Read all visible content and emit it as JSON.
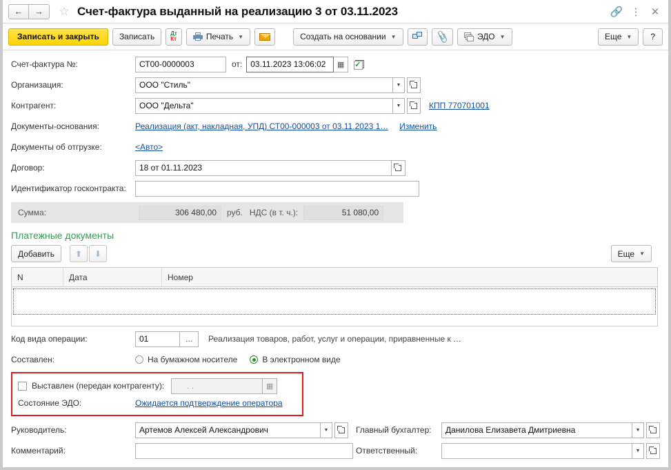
{
  "titlebar": {
    "back_icon": "arrow-left-icon",
    "forward_icon": "arrow-right-icon",
    "favorite_icon": "star-icon",
    "title": "Счет-фактура выданный на реализацию 3 от 03.11.2023",
    "link_icon": "link-icon",
    "menu_icon": "more-vertical-icon",
    "close_icon": "close-icon"
  },
  "toolbar": {
    "save_and_close": "Записать и закрыть",
    "save": "Записать",
    "dt": "Дт",
    "kt": "Кт",
    "print": "Печать",
    "email_icon": "envelope-icon",
    "create_based_on": "Создать на основании",
    "report_icon": "structure-icon",
    "attach_icon": "paperclip-icon",
    "edo": "ЭДО",
    "more": "Еще",
    "help": "?"
  },
  "form": {
    "invoice_number_label": "Счет-фактура №:",
    "invoice_number_value": "СТ00-0000003",
    "date_prefix_label": "от:",
    "date_value": "03.11.2023 13:06:02",
    "calendar_icon": "calendar-icon",
    "status_icon": "document-check-icon",
    "organization_label": "Организация:",
    "organization_value": "ООО \"Стиль\"",
    "counterparty_label": "Контрагент:",
    "counterparty_value": "ООО \"Дельта\"",
    "kpp_link": "КПП 770701001",
    "basis_documents_label": "Документы-основания:",
    "basis_documents_link": "Реализация (акт, накладная, УПД) СТ00-000003 от 03.11.2023 1…",
    "basis_documents_edit": "Изменить",
    "shipping_documents_label": "Документы об отгрузке:",
    "shipping_documents_link": "<Авто>",
    "contract_label": "Договор:",
    "contract_value": "18 от 01.11.2023",
    "gov_contract_label": "Идентификатор госконтракта:",
    "gov_contract_value": "",
    "sum_label": "Сумма:",
    "sum_value": "306 480,00",
    "currency": "руб.",
    "vat_label": "НДС (в т. ч.):",
    "vat_value": "51 080,00"
  },
  "payment_docs": {
    "section_title": "Платежные документы",
    "add_button": "Добавить",
    "move_up_icon": "arrow-up-icon",
    "move_down_icon": "arrow-down-icon",
    "more": "Еще",
    "columns": [
      "N",
      "Дата",
      "Номер"
    ],
    "rows": []
  },
  "operation": {
    "code_label": "Код вида операции:",
    "code_value": "01",
    "select_button": "...",
    "code_description": "Реализация товаров, работ, услуг и операции, приравненные к …",
    "composed_label": "Составлен:",
    "option_paper": "На бумажном носителе",
    "option_electronic": "В электронном виде",
    "selected_option": "electronic"
  },
  "edo_block": {
    "issued_checkbox_label": "Выставлен (передан контрагенту):",
    "issued_checked": false,
    "issued_date_value": ".   .",
    "calendar_icon": "calendar-icon",
    "edo_state_label": "Состояние ЭДО:",
    "edo_state_link": "Ожидается подтверждение оператора",
    "highlight_color": "#e01b1b"
  },
  "signatories": {
    "director_label": "Руководитель:",
    "director_value": "Артемов Алексей Александрович",
    "comment_label": "Комментарий:",
    "comment_value": "",
    "accountant_label": "Главный бухгалтер:",
    "accountant_value": "Данилова Елизавета Дмитриевна",
    "responsible_label": "Ответственный:",
    "responsible_value": ""
  }
}
